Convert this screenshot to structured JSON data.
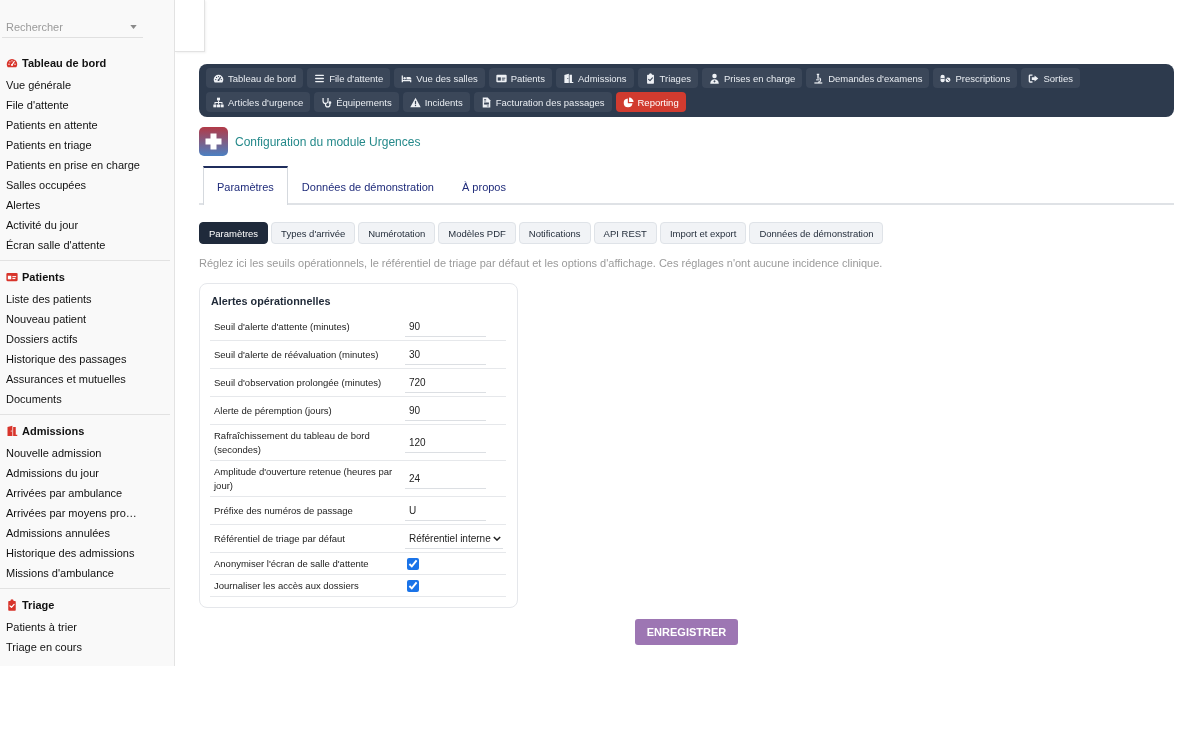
{
  "sidebar": {
    "search": {
      "placeholder": "Rechercher"
    },
    "sections": [
      {
        "title": "Tableau de bord",
        "items": [
          "Vue générale",
          "File d'attente",
          "Patients en attente",
          "Patients en triage",
          "Patients en prise en charge",
          "Salles occupées",
          "Alertes",
          "Activité du jour",
          "Écran salle d'attente"
        ]
      },
      {
        "title": "Patients",
        "items": [
          "Liste des patients",
          "Nouveau patient",
          "Dossiers actifs",
          "Historique des passages",
          "Assurances et mutuelles",
          "Documents"
        ]
      },
      {
        "title": "Admissions",
        "items": [
          "Nouvelle admission",
          "Admissions du jour",
          "Arrivées par ambulance",
          "Arrivées par moyens pro…",
          "Admissions annulées",
          "Historique des admissions",
          "Missions d'ambulance"
        ]
      },
      {
        "title": "Triage",
        "items": [
          "Patients à trier",
          "Triage en cours"
        ]
      }
    ]
  },
  "nav": {
    "items": [
      {
        "label": "Tableau de bord",
        "selected": false
      },
      {
        "label": "File d'attente",
        "selected": false
      },
      {
        "label": "Vue des salles",
        "selected": false
      },
      {
        "label": "Patients",
        "selected": false
      },
      {
        "label": "Admissions",
        "selected": false
      },
      {
        "label": "Triages",
        "selected": false
      },
      {
        "label": "Prises en charge",
        "selected": false
      },
      {
        "label": "Demandes d'examens",
        "selected": false
      },
      {
        "label": "Prescriptions",
        "selected": false
      },
      {
        "label": "Sorties",
        "selected": false
      },
      {
        "label": "Articles d'urgence",
        "selected": false
      },
      {
        "label": "Équipements",
        "selected": false
      },
      {
        "label": "Incidents",
        "selected": false
      },
      {
        "label": "Facturation des passages",
        "selected": false
      },
      {
        "label": "Reporting",
        "selected": true
      }
    ]
  },
  "page": {
    "title": "Configuration du module Urgences"
  },
  "tabs": [
    {
      "label": "Paramètres",
      "selected": true
    },
    {
      "label": "Données de démonstration",
      "selected": false
    },
    {
      "label": "À propos",
      "selected": false
    }
  ],
  "subtabs": [
    {
      "label": "Paramètres",
      "selected": true
    },
    {
      "label": "Types d'arrivée",
      "selected": false
    },
    {
      "label": "Numérotation",
      "selected": false
    },
    {
      "label": "Modèles PDF",
      "selected": false
    },
    {
      "label": "Notifications",
      "selected": false
    },
    {
      "label": "API REST",
      "selected": false
    },
    {
      "label": "Import et export",
      "selected": false
    },
    {
      "label": "Données de démonstration",
      "selected": false
    }
  ],
  "description": "Réglez ici les seuils opérationnels, le référentiel de triage par défaut et les options d'affichage. Ces réglages n'ont aucune incidence clinique.",
  "settings": {
    "title": "Alertes opérationnelles",
    "rows": [
      {
        "kind": "number",
        "label": "Seuil d'alerte d'attente (minutes)",
        "value": "90"
      },
      {
        "kind": "number",
        "label": "Seuil d'alerte de réévaluation (minutes)",
        "value": "30"
      },
      {
        "kind": "number",
        "label": "Seuil d'observation prolongée (minutes)",
        "value": "720"
      },
      {
        "kind": "number",
        "label": "Alerte de péremption (jours)",
        "value": "90"
      },
      {
        "kind": "number",
        "label": "Rafraîchissement du tableau de bord (secondes)",
        "value": "120"
      },
      {
        "kind": "number",
        "label": "Amplitude d'ouverture retenue (heures par jour)",
        "value": "24"
      },
      {
        "kind": "text",
        "label": "Préfixe des numéros de passage",
        "value": "U"
      },
      {
        "kind": "select",
        "label": "Référentiel de triage par défaut",
        "value": "Référentiel interne"
      },
      {
        "kind": "checkbox",
        "label": "Anonymiser l'écran de salle d'attente",
        "checked": true
      },
      {
        "kind": "checkbox",
        "label": "Journaliser les accès aux dossiers",
        "checked": true
      }
    ]
  },
  "save_button": {
    "label": "ENREGISTRER"
  }
}
